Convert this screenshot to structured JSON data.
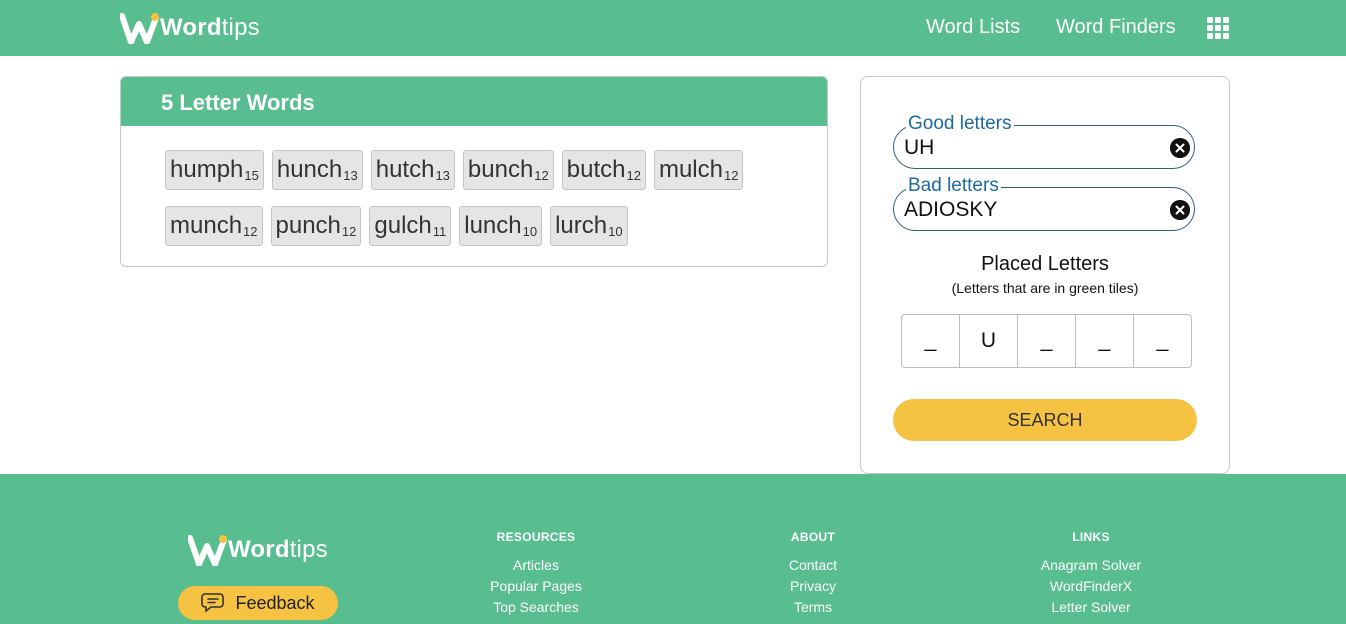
{
  "header": {
    "logo_bold": "Word",
    "logo_light": "tips",
    "nav": [
      "Word Lists",
      "Word Finders"
    ]
  },
  "results": {
    "title": "5 Letter Words",
    "words": [
      {
        "word": "humph",
        "points": "15"
      },
      {
        "word": "hunch",
        "points": "13"
      },
      {
        "word": "hutch",
        "points": "13"
      },
      {
        "word": "bunch",
        "points": "12"
      },
      {
        "word": "butch",
        "points": "12"
      },
      {
        "word": "mulch",
        "points": "12"
      },
      {
        "word": "munch",
        "points": "12"
      },
      {
        "word": "punch",
        "points": "12"
      },
      {
        "word": "gulch",
        "points": "11"
      },
      {
        "word": "lunch",
        "points": "10"
      },
      {
        "word": "lurch",
        "points": "10"
      }
    ]
  },
  "filter": {
    "good": {
      "label": "Good letters",
      "value": "UH"
    },
    "bad": {
      "label": "Bad letters",
      "value": "ADIOSKY"
    },
    "placed_title": "Placed Letters",
    "placed_sub": "(Letters that are in green tiles)",
    "tiles": [
      "_",
      "U",
      "_",
      "_",
      "_"
    ],
    "search_label": "SEARCH"
  },
  "footer": {
    "logo_bold": "Word",
    "logo_light": "tips",
    "feedback": "Feedback",
    "columns": [
      {
        "title": "RESOURCES",
        "links": [
          "Articles",
          "Popular Pages",
          "Top Searches"
        ]
      },
      {
        "title": "ABOUT",
        "links": [
          "Contact",
          "Privacy",
          "Terms"
        ]
      },
      {
        "title": "LINKS",
        "links": [
          "Anagram Solver",
          "WordFinderX",
          "Letter Solver"
        ]
      }
    ]
  },
  "colors": {
    "brand_green": "#58bd8f",
    "accent_yellow": "#f5c242",
    "field_blue": "#1c6ba0"
  }
}
